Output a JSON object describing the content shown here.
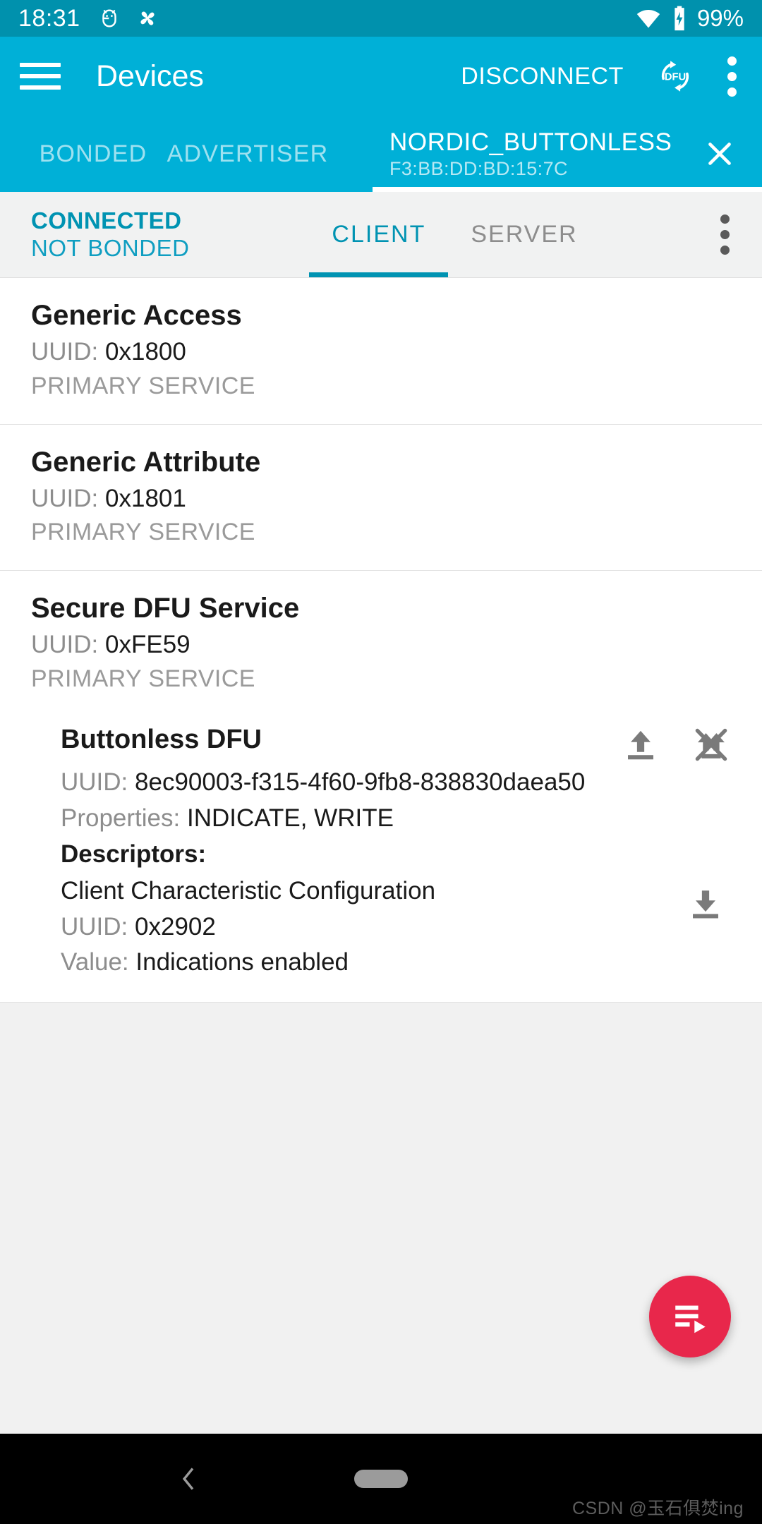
{
  "statusbar": {
    "time": "18:31",
    "battery": "99%",
    "icons": [
      "android-debug-icon",
      "pinwheel-icon",
      "wifi-icon",
      "battery-charging-icon"
    ]
  },
  "appbar": {
    "title": "Devices",
    "disconnect_label": "DISCONNECT",
    "dfu_label": "DFU",
    "menu_icon": "overflow-menu-icon",
    "nav_icon": "hamburger-menu-icon"
  },
  "device_tabs": {
    "bonded_label": "BONDED",
    "advertiser_label": "ADVERTISER",
    "active_device_name": "NORDIC_BUTTONLESS",
    "active_device_address": "F3:BB:DD:BD:15:7C",
    "close_icon": "close-icon"
  },
  "connection": {
    "state": "CONNECTED",
    "bond_state": "NOT BONDED",
    "tabs": [
      {
        "label": "CLIENT",
        "active": true
      },
      {
        "label": "SERVER",
        "active": false
      }
    ],
    "menu_icon": "overflow-menu-icon"
  },
  "services": [
    {
      "name": "Generic Access",
      "uuid_label": "UUID:",
      "uuid_value": "0x1800",
      "type": "PRIMARY SERVICE"
    },
    {
      "name": "Generic Attribute",
      "uuid_label": "UUID:",
      "uuid_value": "0x1801",
      "type": "PRIMARY SERVICE"
    },
    {
      "name": "Secure DFU Service",
      "uuid_label": "UUID:",
      "uuid_value": "0xFE59",
      "type": "PRIMARY SERVICE"
    }
  ],
  "characteristic": {
    "name": "Buttonless DFU",
    "uuid_label": "UUID:",
    "uuid_value": "8ec90003-f315-4f60-9fb8-838830daea50",
    "properties_label": "Properties:",
    "properties_value": "INDICATE, WRITE",
    "write_icon": "upload-icon",
    "indications_icon": "notifications-off-icon",
    "descriptors_label": "Descriptors:",
    "descriptor": {
      "name": "Client Characteristic Configuration",
      "uuid_label": "UUID:",
      "uuid_value": "0x2902",
      "value_label": "Value:",
      "value_value": "Indications enabled",
      "read_icon": "download-icon"
    }
  },
  "fab": {
    "icon": "playlist-play-icon",
    "color": "#e8274b"
  },
  "navbar": {
    "back_icon": "back-chevron-icon",
    "home_icon": "home-pill-icon",
    "watermark": "CSDN @玉石俱焚ing"
  },
  "colors": {
    "statusbar": "#0091ad",
    "appbar": "#00b0d7",
    "accent": "#0093b2",
    "fab": "#e8274b"
  }
}
